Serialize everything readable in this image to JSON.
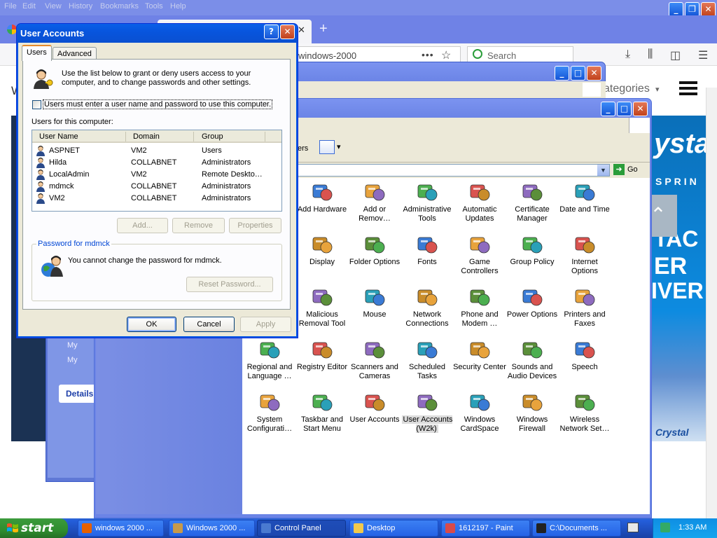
{
  "browser": {
    "menu": [
      "File",
      "Edit",
      "View",
      "History",
      "Bookmarks",
      "Tools",
      "Help"
    ],
    "tab_title": "",
    "url": "windows-2000",
    "search_placeholder": "Search",
    "page": {
      "categories_label": "ategories",
      "ad_text_1": "ysta",
      "ad_text_2": "SPRIN",
      "ad_text_3": "TAC",
      "ad_text_4": "ER",
      "ad_text_5": "IVER",
      "ad_brand": "Crystal"
    }
  },
  "window2": {
    "links": [
      "My",
      "My"
    ],
    "details_label": "Details"
  },
  "control_panel": {
    "toolbar_fragment": "ers",
    "go_label": "Go",
    "items": [
      {
        "label": "Add Hardware",
        "icon": "add-hardware-icon"
      },
      {
        "label": "Add or Remov…",
        "icon": "add-remove-programs-icon"
      },
      {
        "label": "Administrative Tools",
        "icon": "administrative-tools-icon"
      },
      {
        "label": "Automatic Updates",
        "icon": "automatic-updates-icon"
      },
      {
        "label": "Certificate Manager",
        "icon": "certificate-manager-icon"
      },
      {
        "label": "Date and Time",
        "icon": "date-time-icon"
      },
      {
        "label": "Display",
        "icon": "display-icon"
      },
      {
        "label": "Folder Options",
        "icon": "folder-options-icon"
      },
      {
        "label": "Fonts",
        "icon": "fonts-icon"
      },
      {
        "label": "Game Controllers",
        "icon": "game-controllers-icon"
      },
      {
        "label": "Group Policy",
        "icon": "group-policy-icon"
      },
      {
        "label": "Internet Options",
        "icon": "internet-options-icon"
      },
      {
        "label": "Malicious Removal Tool",
        "icon": "malicious-removal-tool-icon"
      },
      {
        "label": "Mouse",
        "icon": "mouse-icon"
      },
      {
        "label": "Network Connections",
        "icon": "network-connections-icon"
      },
      {
        "label": "Phone and Modem …",
        "icon": "phone-modem-icon"
      },
      {
        "label": "Power Options",
        "icon": "power-options-icon"
      },
      {
        "label": "Printers and Faxes",
        "icon": "printers-faxes-icon"
      },
      {
        "label": "Regional and Language …",
        "icon": "regional-language-icon"
      },
      {
        "label": "Registry Editor",
        "icon": "registry-editor-icon"
      },
      {
        "label": "Scanners and Cameras",
        "icon": "scanners-cameras-icon"
      },
      {
        "label": "Scheduled Tasks",
        "icon": "scheduled-tasks-icon"
      },
      {
        "label": "Security Center",
        "icon": "security-center-icon"
      },
      {
        "label": "Sounds and Audio Devices",
        "icon": "sounds-audio-icon"
      },
      {
        "label": "Speech",
        "icon": "speech-icon"
      },
      {
        "label": "System Configurati…",
        "icon": "system-configuration-icon"
      },
      {
        "label": "Taskbar and Start Menu",
        "icon": "taskbar-start-menu-icon"
      },
      {
        "label": "User Accounts",
        "icon": "user-accounts-icon"
      },
      {
        "label": "User Accounts (W2k)",
        "icon": "user-accounts-w2k-icon",
        "selected": true
      },
      {
        "label": "Windows CardSpace",
        "icon": "windows-cardspace-icon"
      },
      {
        "label": "Windows Firewall",
        "icon": "windows-firewall-icon"
      },
      {
        "label": "Wireless Network Set…",
        "icon": "wireless-network-icon"
      }
    ]
  },
  "dialog": {
    "title": "User Accounts",
    "help_glyph": "?",
    "close_glyph": "✕",
    "tabs": [
      "Users",
      "Advanced"
    ],
    "description": "Use the list below to grant or deny users access to your computer, and to change passwords and other settings.",
    "checkbox_label": "Users must enter a user name and password to use this computer.",
    "checkbox_checked": false,
    "users_label": "Users for this computer:",
    "columns": [
      "User Name",
      "Domain",
      "Group"
    ],
    "users": [
      {
        "name": "ASPNET",
        "domain": "VM2",
        "group": "Users"
      },
      {
        "name": "Hilda",
        "domain": "COLLABNET",
        "group": "Administrators"
      },
      {
        "name": "LocalAdmin",
        "domain": "VM2",
        "group": "Remote Deskto…"
      },
      {
        "name": "mdmck",
        "domain": "COLLABNET",
        "group": "Administrators"
      },
      {
        "name": "VM2",
        "domain": "COLLABNET",
        "group": "Administrators"
      }
    ],
    "add_label": "Add...",
    "remove_label": "Remove",
    "properties_label": "Properties",
    "password_group_label": "Password for mdmck",
    "password_message": "You cannot change the password for mdmck.",
    "reset_label": "Reset Password...",
    "ok_label": "OK",
    "cancel_label": "Cancel",
    "apply_label": "Apply"
  },
  "taskbar": {
    "start_label": "start",
    "buttons": [
      {
        "label": "windows 2000 ...",
        "icon": "firefox-icon"
      },
      {
        "label": "Windows 2000 ...",
        "icon": "user-accounts-icon"
      },
      {
        "label": "Control Panel",
        "icon": "control-panel-icon",
        "active": true
      },
      {
        "label": "Desktop",
        "icon": "folder-icon"
      },
      {
        "label": "1612197 - Paint",
        "icon": "paint-icon"
      },
      {
        "label": "C:\\Documents ...",
        "icon": "command-prompt-icon"
      }
    ],
    "clock": "1:33 AM"
  },
  "colors": {
    "xp_blue": "#0054e3",
    "dialog_face": "#ece9d8",
    "taskbar_blue": "#245edb",
    "start_green": "#3c9b3c"
  }
}
